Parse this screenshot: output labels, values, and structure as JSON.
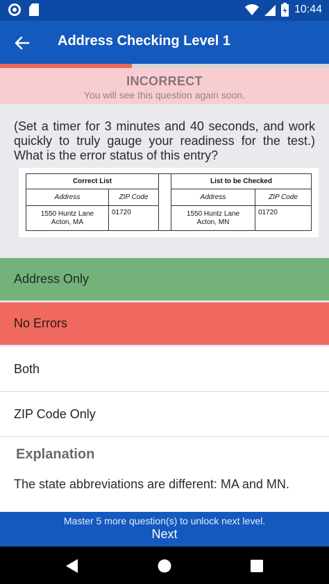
{
  "status_bar": {
    "time": "10:44"
  },
  "app_bar": {
    "title": "Address Checking Level 1"
  },
  "progress": {
    "fraction": 0.4
  },
  "banner": {
    "title": "INCORRECT",
    "subtitle": "You will see this question again soon."
  },
  "question": {
    "text": "(Set a timer for 3 minutes and 40 seconds, and work quickly to truly gauge your readiness for the test.) What is the error status of this entry?"
  },
  "address_table": {
    "correct_header": "Correct List",
    "check_header": "List to be Checked",
    "col_address": "Address",
    "col_zip": "ZIP Code",
    "correct_line1": "1550 Huntz Lane",
    "correct_line2": "Acton, MA",
    "correct_zip": "01720",
    "check_line1": "1550 Huntz Lane",
    "check_line2": "Acton, MN",
    "check_zip": "01720"
  },
  "options": [
    {
      "label": "Address Only",
      "state": "correct"
    },
    {
      "label": "No Errors",
      "state": "selected-wrong"
    },
    {
      "label": "Both",
      "state": "neutral"
    },
    {
      "label": "ZIP Code Only",
      "state": "neutral"
    }
  ],
  "explanation": {
    "title": "Explanation",
    "text": "The state abbreviations are different: MA and MN."
  },
  "footer": {
    "message": "Master 5 more question(s) to unlock next level.",
    "next_label": "Next"
  },
  "colors": {
    "app_bar": "#1459bd",
    "correct": "#73b27a",
    "wrong": "#f0695e",
    "banner": "#f8cdd2"
  }
}
